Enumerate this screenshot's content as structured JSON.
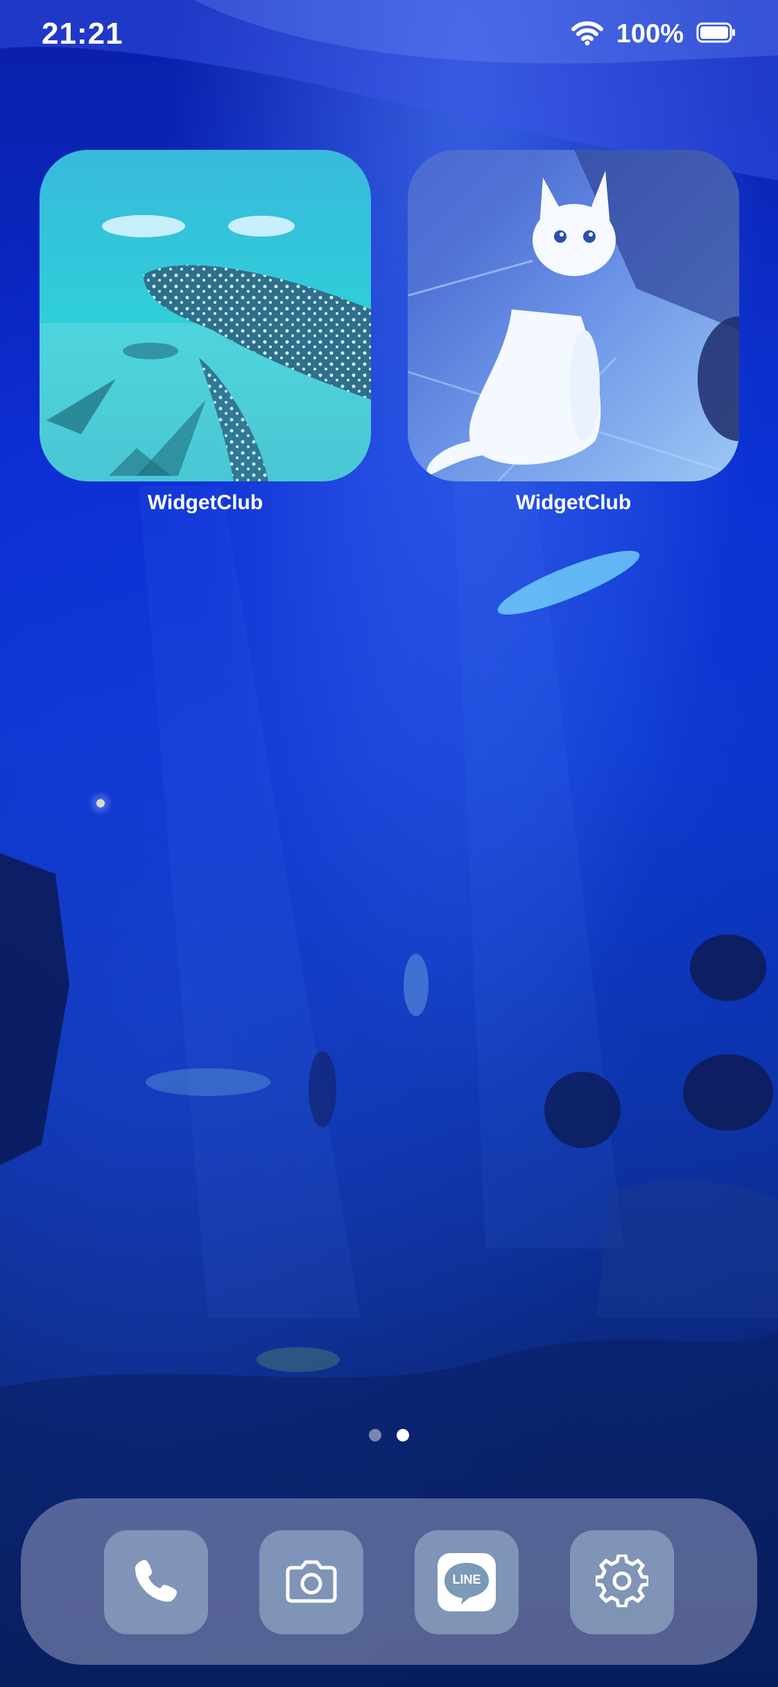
{
  "status_bar": {
    "time": "21:21",
    "battery_percent": "100%"
  },
  "widgets": [
    {
      "label": "WidgetClub",
      "image": "whale-shark-aquarium"
    },
    {
      "label": "WidgetClub",
      "image": "white-cat-illustration"
    }
  ],
  "page_indicator": {
    "pages": 2,
    "current": 2
  },
  "dock": {
    "apps": [
      {
        "name": "Phone",
        "icon": "phone-icon"
      },
      {
        "name": "Camera",
        "icon": "camera-icon"
      },
      {
        "name": "LINE",
        "icon": "line-icon",
        "badge_text": "LINE"
      },
      {
        "name": "Settings",
        "icon": "gear-icon"
      }
    ]
  },
  "colors": {
    "accent": "#0a30c8",
    "dock_bg": "#b4b4d2",
    "app_tile": "#96afc8"
  }
}
